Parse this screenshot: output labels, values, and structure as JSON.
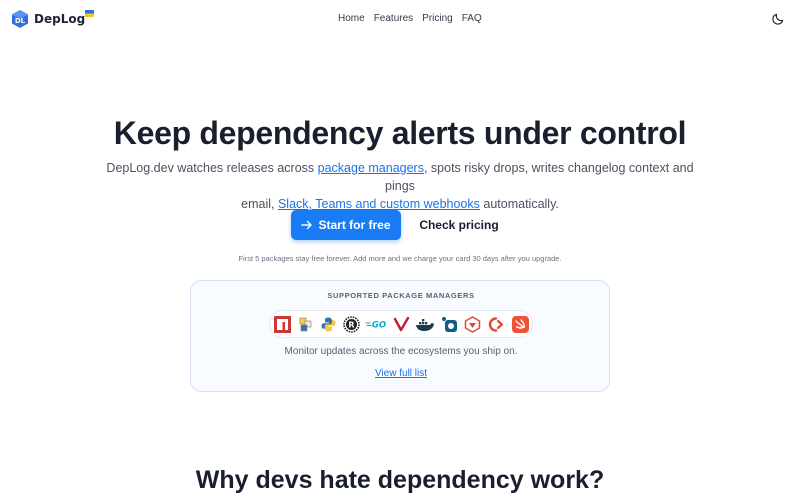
{
  "header": {
    "brand": "DepLog",
    "nav": [
      "Home",
      "Features",
      "Pricing",
      "FAQ"
    ],
    "theme_icon": "moon-icon"
  },
  "hero": {
    "title": "Keep dependency alerts under control",
    "desc_line1_before": "DepLog.dev watches releases across ",
    "desc_link_pm": "package managers",
    "desc_line1_after": ", spots risky drops, writes changelog context and pings",
    "desc_line2_before": "email, ",
    "desc_link_integrations": "Slack, Teams and custom webhooks",
    "desc_line2_after": " automatically.",
    "cta_primary": "Start for free",
    "cta_secondary": "Check pricing",
    "fine_print": "First 5 packages stay free forever. Add more and we charge your card 30 days after you upgrade."
  },
  "package_managers": {
    "title": "SUPPORTED PACKAGE MANAGERS",
    "icons": [
      "npm-icon",
      "pypi-icon",
      "python-icon",
      "rust-icon",
      "go-icon",
      "maven-icon",
      "docker-icon",
      "dart-icon",
      "gem-icon",
      "composer-icon",
      "swift-icon"
    ],
    "subtitle": "Monitor updates across the ecosystems you ship on.",
    "link": "View full list"
  },
  "section": {
    "title": "Why devs hate dependency work?"
  },
  "colors": {
    "accent": "#1a7cf5",
    "link": "#1a73e8",
    "heading": "#1a1f2e"
  }
}
